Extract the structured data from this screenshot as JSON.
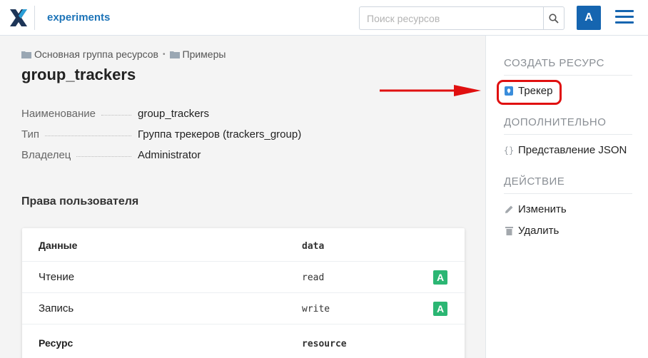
{
  "header": {
    "app_title": "experiments",
    "search_placeholder": "Поиск ресурсов",
    "user_initial": "A"
  },
  "breadcrumb": {
    "items": [
      "Основная группа ресурсов",
      "Примеры"
    ],
    "separator": "•"
  },
  "page_title": "group_trackers",
  "properties": [
    {
      "key": "Наименование",
      "value": "group_trackers"
    },
    {
      "key": "Тип",
      "value": "Группа трекеров (trackers_group)"
    },
    {
      "key": "Владелец",
      "value": "Administrator"
    }
  ],
  "permissions": {
    "title": "Права пользователя",
    "rows": [
      {
        "label": "Данные",
        "code": "data",
        "badge": ""
      },
      {
        "label": "Чтение",
        "code": "read",
        "badge": "A"
      },
      {
        "label": "Запись",
        "code": "write",
        "badge": "A"
      },
      {
        "label": "Ресурс",
        "code": "resource",
        "badge": ""
      }
    ]
  },
  "sidebar": {
    "create_heading": "СОЗДАТЬ РЕСУРС",
    "create_items": [
      {
        "label": "Трекер",
        "icon": "tracker-icon"
      }
    ],
    "extra_heading": "ДОПОЛНИТЕЛЬНО",
    "extra_items": [
      {
        "label": "Представление JSON",
        "icon": "braces-icon"
      }
    ],
    "action_heading": "ДЕЙСТВИЕ",
    "action_items": [
      {
        "label": "Изменить",
        "icon": "pencil-icon"
      },
      {
        "label": "Удалить",
        "icon": "trash-icon"
      }
    ]
  },
  "colors": {
    "brand": "#1565b0",
    "badge": "#2bb673",
    "annotation": "#e01010"
  }
}
